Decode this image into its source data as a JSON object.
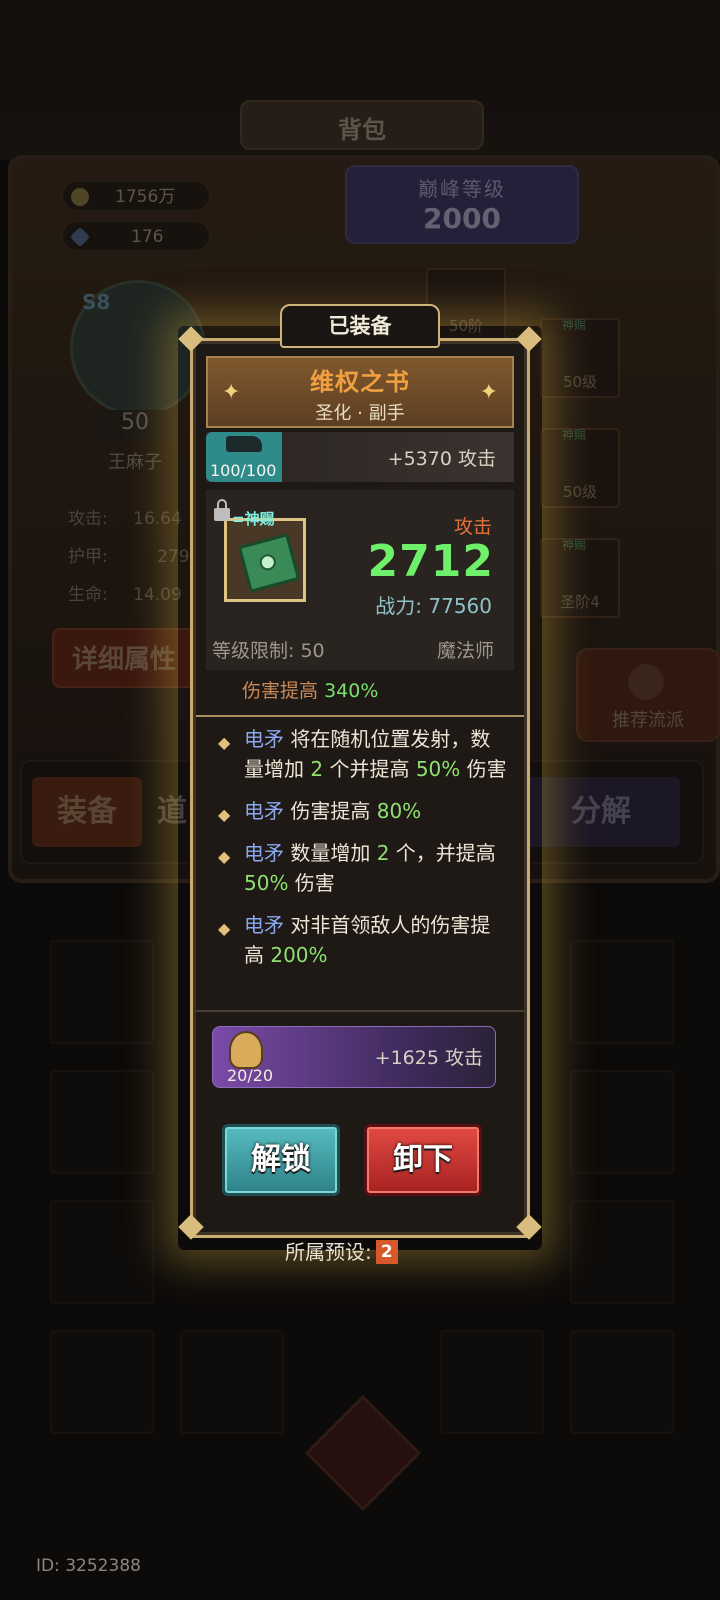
{
  "background": {
    "title": "背包",
    "gold": "1756万",
    "gems": "176",
    "peak_level_label": "巅峰等级",
    "peak_level_value": "2000",
    "avatar_level": "50",
    "avatar_badge": "S8",
    "player_name": "王麻子",
    "stats": [
      {
        "label": "攻击:",
        "value": "16.64"
      },
      {
        "label": "护甲:",
        "value": "279"
      },
      {
        "label": "生命:",
        "value": "14.09"
      }
    ],
    "detail_button": "详细属性",
    "slots": [
      {
        "tag": "神赐",
        "level": "50级"
      },
      {
        "tag": "神赐",
        "level": "50级"
      },
      {
        "tag": "神赐",
        "level": "圣阶4"
      }
    ],
    "center_slot_level": "50阶",
    "recommend_button": "推荐流派",
    "tabs": {
      "equip": "装备",
      "items": "道",
      "decompose": "分解"
    }
  },
  "modal": {
    "status_tab": "已装备",
    "item_name": "维权之书",
    "item_type": "圣化 · 副手",
    "enhance_count": "100/100",
    "enhance_bonus": "+5370 攻击",
    "divine_tag": "神赐",
    "stat_label": "攻击",
    "stat_value": "2712",
    "power": "战力: 77560",
    "level_limit": "等级限制: 50",
    "class": "魔法师",
    "cut_off_line": {
      "text": "伤害提高",
      "value": "340%"
    },
    "effects": [
      {
        "segments": [
          {
            "t": "电矛",
            "c": "kw"
          },
          {
            "t": " 将在随机位置发射，数量增加 ",
            "c": ""
          },
          {
            "t": "2",
            "c": "num"
          },
          {
            "t": " 个并提高 ",
            "c": ""
          },
          {
            "t": "50%",
            "c": "num"
          },
          {
            "t": " 伤害",
            "c": ""
          }
        ]
      },
      {
        "segments": [
          {
            "t": "电矛",
            "c": "kw"
          },
          {
            "t": " 伤害提高 ",
            "c": ""
          },
          {
            "t": "80%",
            "c": "num"
          }
        ]
      },
      {
        "segments": [
          {
            "t": "电矛",
            "c": "kw"
          },
          {
            "t": " 数量增加 ",
            "c": ""
          },
          {
            "t": "2",
            "c": "num"
          },
          {
            "t": " 个，并提高 ",
            "c": ""
          },
          {
            "t": "50%",
            "c": "num"
          },
          {
            "t": " 伤害",
            "c": ""
          }
        ]
      },
      {
        "segments": [
          {
            "t": "电矛",
            "c": "kw"
          },
          {
            "t": " 对非首领敌人的伤害提高 ",
            "c": ""
          },
          {
            "t": "200%",
            "c": "num"
          }
        ]
      }
    ],
    "blessing_count": "20/20",
    "blessing_bonus": "+1625 攻击",
    "unlock_button": "解锁",
    "unequip_button": "卸下",
    "preset_label": "所属预设:",
    "preset_value": "2"
  },
  "footer": {
    "id": "ID: 3252388"
  }
}
